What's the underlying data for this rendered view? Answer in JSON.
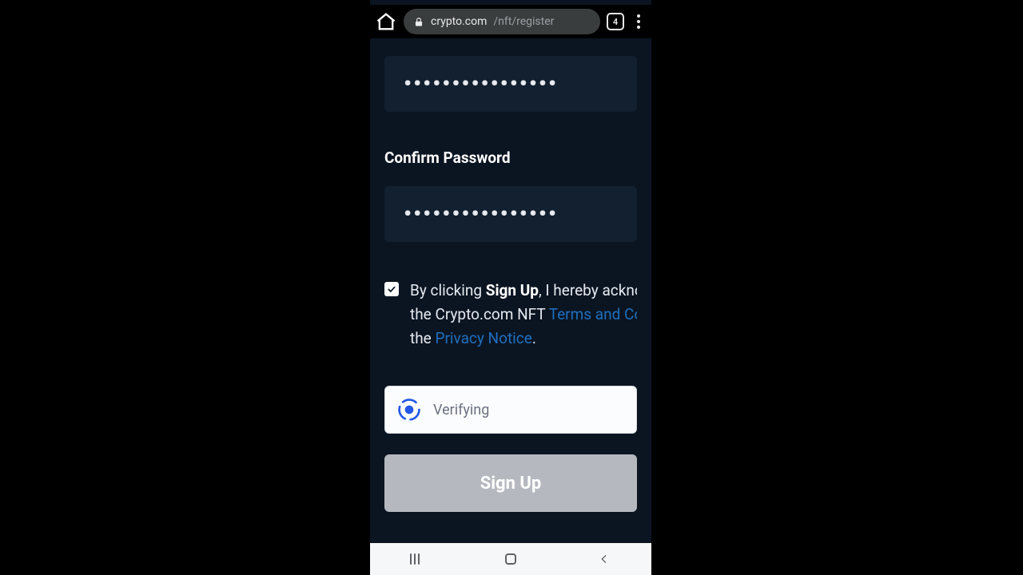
{
  "browser": {
    "url_host": "crypto.com",
    "url_path": "/nft/register",
    "open_tabs": "4"
  },
  "form": {
    "password_value": "••••••••••••••••",
    "confirm_label": "Confirm Password",
    "confirm_value": "••••••••••••••••",
    "consent": {
      "pre": "By clicking ",
      "strong": "Sign Up",
      "line1_tail": ", I hereby acknowledge",
      "line2_pre": "the Crypto.com NFT ",
      "terms_link": "Terms and Conditions",
      "line3_pre": "the ",
      "privacy_link": "Privacy Notice",
      "period": "."
    }
  },
  "captcha": {
    "status": "Verifying"
  },
  "actions": {
    "signup_label": "Sign Up"
  }
}
